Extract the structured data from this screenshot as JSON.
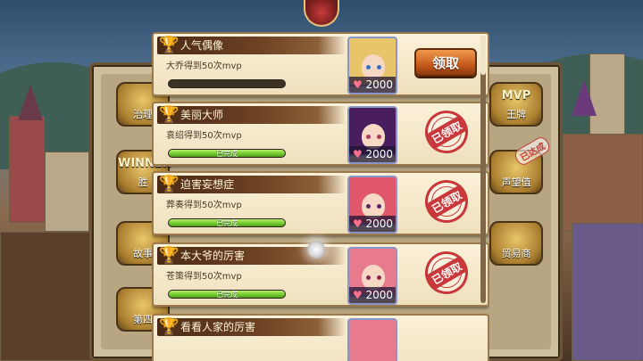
{
  "achievements": [
    {
      "title": "人气偶像",
      "description": "大乔得到50次mvp",
      "progress_label": "",
      "progress": 0,
      "reward": "2000",
      "status": "claimable",
      "action_label": "领取",
      "hair_color": "#e8c46a",
      "eye_color": "#3f6fc0"
    },
    {
      "title": "美丽大师",
      "description": "袁绍得到50次mvp",
      "progress_label": "已完成",
      "progress": 1,
      "reward": "2000",
      "status": "claimed",
      "action_label": "已领取",
      "hair_color": "#4a1e5e",
      "eye_color": "#b03a5a"
    },
    {
      "title": "迫害妄想症",
      "description": "葬奏得到50次mvp",
      "progress_label": "已完成",
      "progress": 1,
      "reward": "2000",
      "status": "claimed",
      "action_label": "已领取",
      "hair_color": "#e0566a",
      "eye_color": "#5a2a6a"
    },
    {
      "title": "本大爷的厉害",
      "description": "苍策得到50次mvp",
      "progress_label": "已完成",
      "progress": 1,
      "reward": "2000",
      "status": "claimed",
      "action_label": "已领取",
      "hair_color": "#e87a8e",
      "eye_color": "#8a2a4a"
    },
    {
      "title": "看看人家的厉害",
      "description": "",
      "progress_label": "",
      "progress": 0,
      "reward": "",
      "status": "",
      "action_label": "",
      "hair_color": "#e87a8e",
      "eye_color": "#8a2a4a"
    }
  ],
  "side_badges": {
    "left": [
      "治理",
      "WINNER",
      "胜",
      "故事",
      "第四"
    ],
    "right": [
      "MVP",
      "王牌",
      "已达成",
      "声望值",
      "贸易商"
    ]
  },
  "colors": {
    "accent": "#c55a1c",
    "stamp": "#c8383a",
    "progress": "#6fc72f"
  }
}
